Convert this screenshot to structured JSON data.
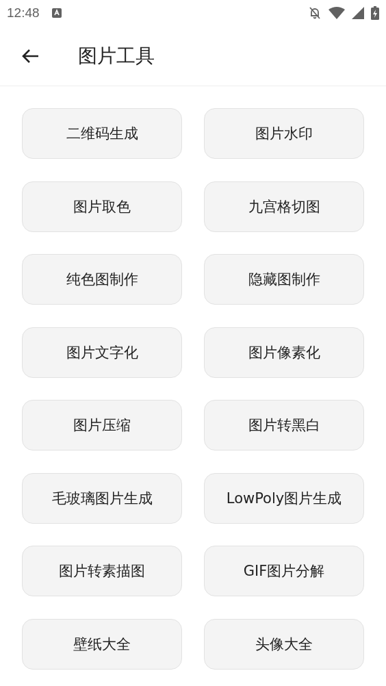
{
  "status_bar": {
    "time": "12:48"
  },
  "app_bar": {
    "title": "图片工具"
  },
  "tools": [
    {
      "label": "二维码生成"
    },
    {
      "label": "图片水印"
    },
    {
      "label": "图片取色"
    },
    {
      "label": "九宫格切图"
    },
    {
      "label": "纯色图制作"
    },
    {
      "label": "隐藏图制作"
    },
    {
      "label": "图片文字化"
    },
    {
      "label": "图片像素化"
    },
    {
      "label": "图片压缩"
    },
    {
      "label": "图片转黑白"
    },
    {
      "label": "毛玻璃图片生成"
    },
    {
      "label": "LowPoly图片生成"
    },
    {
      "label": "图片转素描图"
    },
    {
      "label": "GIF图片分解"
    },
    {
      "label": "壁纸大全"
    },
    {
      "label": "头像大全"
    }
  ]
}
